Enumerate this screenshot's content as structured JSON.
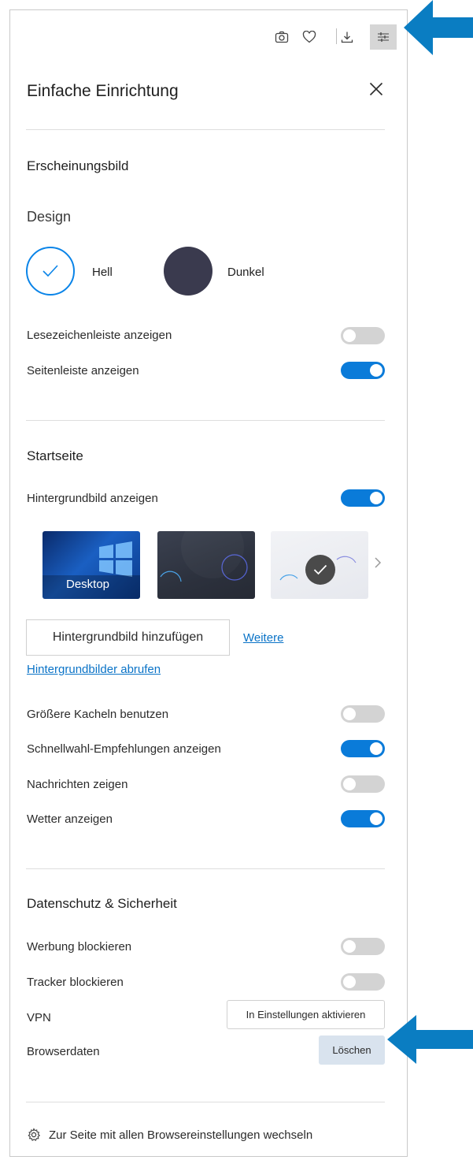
{
  "toolbar": {
    "icons": [
      "camera-icon",
      "heart-icon",
      "download-icon",
      "sliders-icon"
    ]
  },
  "panel": {
    "title": "Einfache Einrichtung",
    "close_icon": "close-icon"
  },
  "appearance": {
    "heading": "Erscheinungsbild",
    "design_label": "Design",
    "light_label": "Hell",
    "dark_label": "Dunkel",
    "selected_theme": "Hell",
    "bookmarks_bar_label": "Lesezeichenleiste anzeigen",
    "bookmarks_bar_on": false,
    "sidebar_label": "Seitenleiste anzeigen",
    "sidebar_on": true
  },
  "start": {
    "heading": "Startseite",
    "wallpaper_label": "Hintergrundbild anzeigen",
    "wallpaper_on": true,
    "thumb_desktop_label": "Desktop",
    "add_wallpaper_button": "Hintergrundbild hinzufügen",
    "more_link": "Weitere",
    "get_wallpapers_link": "Hintergrundbilder abrufen",
    "bigger_tiles_label": "Größere Kacheln benutzen",
    "bigger_tiles_on": false,
    "speed_dial_label": "Schnellwahl-Empfehlungen anzeigen",
    "speed_dial_on": true,
    "news_label": "Nachrichten zeigen",
    "news_on": false,
    "weather_label": "Wetter anzeigen",
    "weather_on": true
  },
  "privacy": {
    "heading": "Datenschutz & Sicherheit",
    "ads_label": "Werbung blockieren",
    "ads_on": false,
    "trackers_label": "Tracker blockieren",
    "trackers_on": false,
    "vpn_label": "VPN",
    "vpn_button": "In Einstellungen aktivieren",
    "browser_data_label": "Browserdaten",
    "clear_button": "Löschen"
  },
  "footer": {
    "all_settings_link": "Zur Seite mit allen Browsereinstellungen wechseln"
  },
  "colors": {
    "accent": "#0a7bd9",
    "annotation_arrow": "#0a7dc2",
    "dark_theme": "#3a3a4e"
  }
}
